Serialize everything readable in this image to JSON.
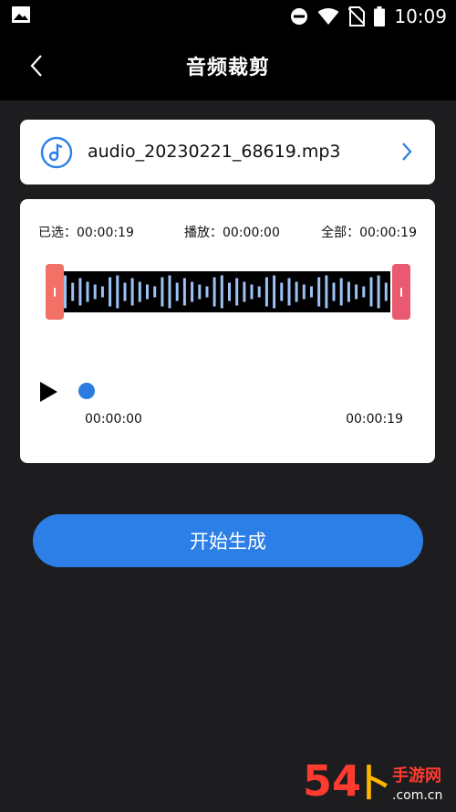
{
  "status_bar": {
    "time": "10:09",
    "icons": [
      "image-icon",
      "do-not-disturb-icon",
      "wifi-icon",
      "no-sim-icon",
      "battery-icon"
    ]
  },
  "header": {
    "title": "音频裁剪"
  },
  "file": {
    "name": "audio_20230221_68619.mp3",
    "icon": "music-note-icon"
  },
  "trimmer": {
    "selected_label": "已选：00:00:19",
    "playing_label": "播放：00:00:00",
    "total_label": "全部：00:00:19",
    "time_start": "00:00:00",
    "time_end": "00:00:19",
    "progress": 0
  },
  "actions": {
    "generate_label": "开始生成"
  },
  "colors": {
    "accent": "#2b7fe6",
    "handle_left": "#f27065",
    "handle_right": "#e95a70",
    "waveform_bars": "#9cc2f4"
  },
  "watermark": {
    "text": "54下手游网 .com.cn"
  }
}
